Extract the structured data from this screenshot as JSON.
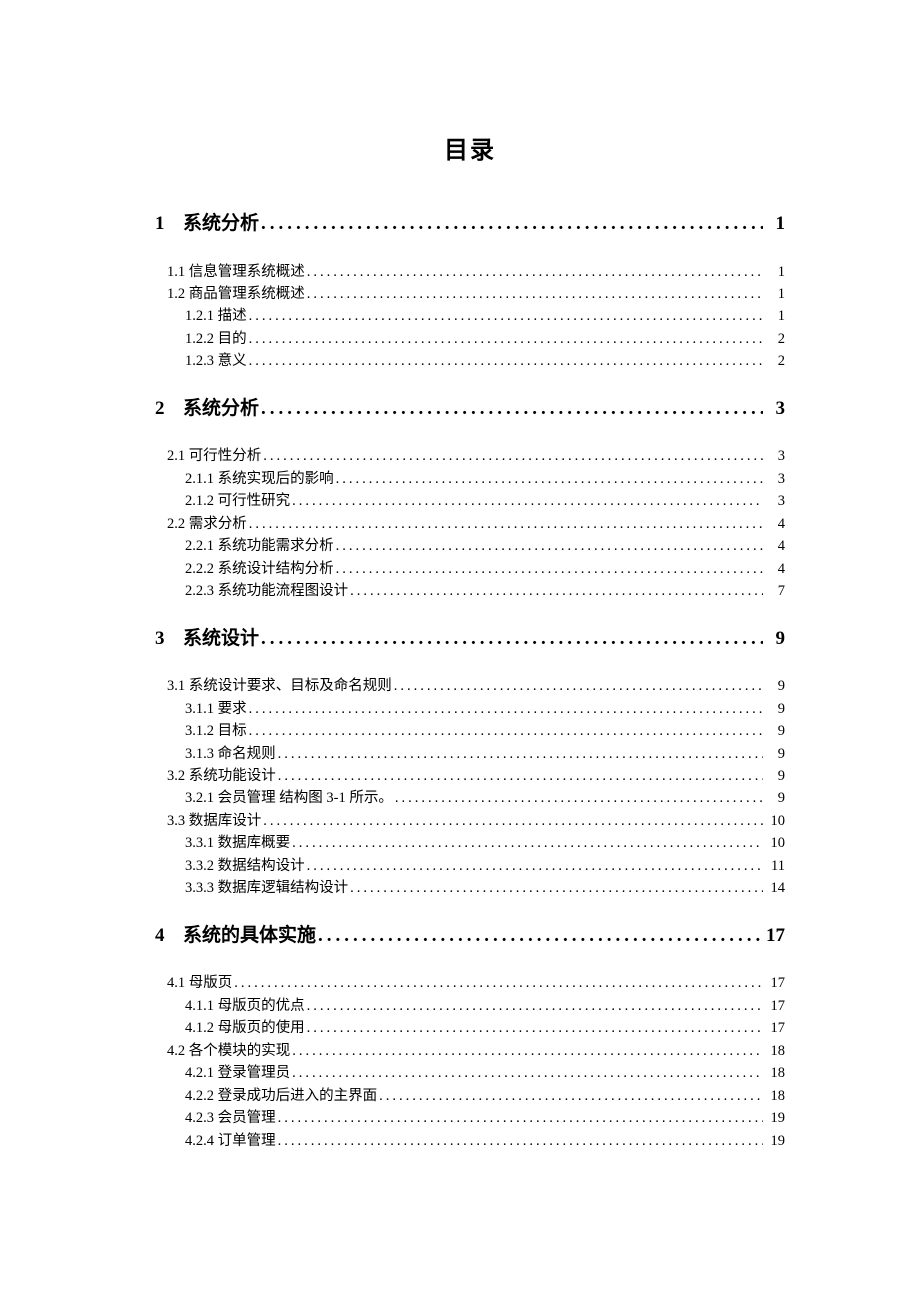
{
  "title": "目录",
  "sections": [
    {
      "num": "1",
      "label": "系统分析",
      "page": "1",
      "children": [
        {
          "level": 2,
          "label": "1.1 信息管理系统概述",
          "page": "1"
        },
        {
          "level": 2,
          "label": "1.2 商品管理系统概述",
          "page": "1"
        },
        {
          "level": 3,
          "label": "1.2.1 描述",
          "page": "1"
        },
        {
          "level": 3,
          "label": "1.2.2 目的",
          "page": "2"
        },
        {
          "level": 3,
          "label": "1.2.3 意义",
          "page": "2"
        }
      ]
    },
    {
      "num": "2",
      "label": "系统分析",
      "page": "3",
      "children": [
        {
          "level": 2,
          "label": "2.1 可行性分析",
          "page": "3"
        },
        {
          "level": 3,
          "label": "2.1.1 系统实现后的影响",
          "page": "3"
        },
        {
          "level": 3,
          "label": "2.1.2 可行性研究",
          "page": "3"
        },
        {
          "level": 2,
          "label": "2.2 需求分析",
          "page": "4"
        },
        {
          "level": 3,
          "label": "2.2.1 系统功能需求分析",
          "page": "4"
        },
        {
          "level": 3,
          "label": "2.2.2 系统设计结构分析",
          "page": "4"
        },
        {
          "level": 3,
          "label": "2.2.3 系统功能流程图设计",
          "page": "7"
        }
      ]
    },
    {
      "num": "3",
      "label": "系统设计",
      "page": "9",
      "children": [
        {
          "level": 2,
          "label": "3.1 系统设计要求、目标及命名规则",
          "page": "9"
        },
        {
          "level": 3,
          "label": "3.1.1 要求",
          "page": "9"
        },
        {
          "level": 3,
          "label": "3.1.2 目标",
          "page": "9"
        },
        {
          "level": 3,
          "label": "3.1.3 命名规则",
          "page": "9"
        },
        {
          "level": 2,
          "label": "3.2 系统功能设计",
          "page": "9"
        },
        {
          "level": 3,
          "label": "3.2.1 会员管理 结构图 3-1 所示。",
          "page": "9"
        },
        {
          "level": 2,
          "label": "3.3 数据库设计",
          "page": "10"
        },
        {
          "level": 3,
          "label": "3.3.1 数据库概要",
          "page": "10"
        },
        {
          "level": 3,
          "label": "3.3.2 数据结构设计",
          "page": "11"
        },
        {
          "level": 3,
          "label": "3.3.3 数据库逻辑结构设计",
          "page": "14"
        }
      ]
    },
    {
      "num": "4",
      "label": "系统的具体实施",
      "page": "17",
      "children": [
        {
          "level": 2,
          "label": "4.1 母版页",
          "page": "17"
        },
        {
          "level": 3,
          "label": "4.1.1 母版页的优点",
          "page": "17"
        },
        {
          "level": 3,
          "label": "4.1.2 母版页的使用",
          "page": "17"
        },
        {
          "level": 2,
          "label": "4.2 各个模块的实现",
          "page": "18"
        },
        {
          "level": 3,
          "label": "4.2.1 登录管理员",
          "page": "18"
        },
        {
          "level": 3,
          "label": "4.2.2 登录成功后进入的主界面",
          "page": "18"
        },
        {
          "level": 3,
          "label": "4.2.3 会员管理",
          "page": "19"
        },
        {
          "level": 3,
          "label": "4.2.4 订单管理",
          "page": "19"
        }
      ]
    }
  ]
}
